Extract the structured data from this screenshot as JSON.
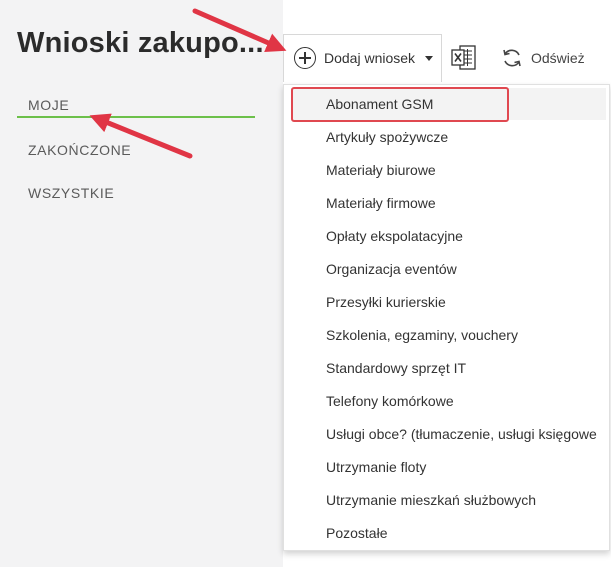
{
  "page": {
    "title": "Wnioski zakupo..."
  },
  "nav": {
    "items": [
      {
        "label": "MOJE"
      },
      {
        "label": "ZAKOŃCZONE"
      },
      {
        "label": "WSZYSTKIE"
      }
    ],
    "active": "MOJE",
    "active_color": "#6cc04a"
  },
  "toolbar": {
    "add_label": "Dodaj wniosek",
    "add_icon": "plus-circle-icon",
    "export_icon": "excel-icon",
    "refresh_icon": "refresh-icon",
    "refresh_label": "Odśwież"
  },
  "dropdown": {
    "items": [
      {
        "label": "Abonament GSM"
      },
      {
        "label": "Artykuły spożywcze"
      },
      {
        "label": "Materiały biurowe"
      },
      {
        "label": "Materiały firmowe"
      },
      {
        "label": "Opłaty ekspolatacyjne"
      },
      {
        "label": "Organizacja eventów"
      },
      {
        "label": "Przesyłki kurierskie"
      },
      {
        "label": "Szkolenia, egzaminy, vouchery"
      },
      {
        "label": "Standardowy sprzęt IT"
      },
      {
        "label": "Telefony komórkowe"
      },
      {
        "label": "Usługi obce? (tłumaczenie, usługi księgowe"
      },
      {
        "label": "Utrzymanie floty"
      },
      {
        "label": "Utrzymanie mieszkań służbowych"
      },
      {
        "label": "Pozostałe"
      }
    ],
    "highlighted": "Abonament GSM"
  },
  "annotations": {
    "arrow_color": "#e03545",
    "box_color": "#e04850"
  }
}
